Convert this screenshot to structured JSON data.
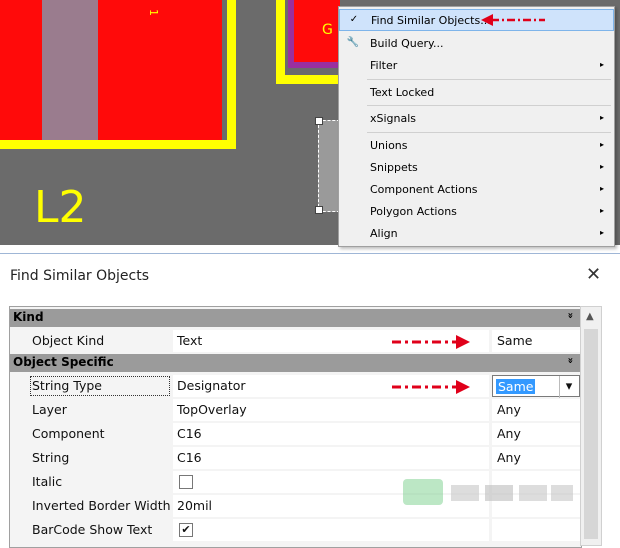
{
  "pcb": {
    "designator_label": "L2",
    "pad_label": "G",
    "rotated_label": "1"
  },
  "context_menu": {
    "items": [
      {
        "label": "Find Similar Objects...",
        "has_submenu": false,
        "icon": "check-icon",
        "highlighted": true
      },
      {
        "label": "Build Query...",
        "has_submenu": false,
        "icon": "query-tool-icon"
      },
      {
        "label": "Filter",
        "has_submenu": true
      },
      {
        "label": "Text Locked",
        "has_submenu": false
      },
      {
        "label": "xSignals",
        "has_submenu": true
      },
      {
        "label": "Unions",
        "has_submenu": true
      },
      {
        "label": "Snippets",
        "has_submenu": true
      },
      {
        "label": "Component Actions",
        "has_submenu": true
      },
      {
        "label": "Polygon Actions",
        "has_submenu": true
      },
      {
        "label": "Align",
        "has_submenu": true
      }
    ],
    "submenu_glyph": "▸",
    "check_glyph": "✓"
  },
  "dialog": {
    "title": "Find Similar Objects",
    "close_glyph": "✕",
    "categories": [
      {
        "label": "Kind",
        "chevron": "»"
      },
      {
        "label": "Object Specific",
        "chevron": "»"
      }
    ],
    "kind_rows": [
      {
        "name": "Object Kind",
        "value": "Text",
        "compare": "Same"
      }
    ],
    "object_rows": [
      {
        "name": "String Type",
        "value": "Designator",
        "compare": "Same",
        "dropdown": true
      },
      {
        "name": "Layer",
        "value": "TopOverlay",
        "compare": "Any"
      },
      {
        "name": "Component",
        "value": "C16",
        "compare": "Any"
      },
      {
        "name": "String",
        "value": "C16",
        "compare": "Any"
      },
      {
        "name": "Italic",
        "value": "",
        "compare": "",
        "checkbox": false
      },
      {
        "name": "Inverted Border Width",
        "value": "20mil",
        "compare": ""
      },
      {
        "name": "BarCode Show Text",
        "value": "",
        "compare": "",
        "checkbox": true
      }
    ],
    "checkbox_glyph": "✔",
    "dropdown_glyph": "▾"
  },
  "colors": {
    "pcb_background": "#6b6b6b",
    "pad_red": "#ff0a0a",
    "silkscreen_yellow": "#ffff00",
    "annotation_arrow_red": "#e0001a",
    "menu_highlight": "#cfe3fb"
  }
}
